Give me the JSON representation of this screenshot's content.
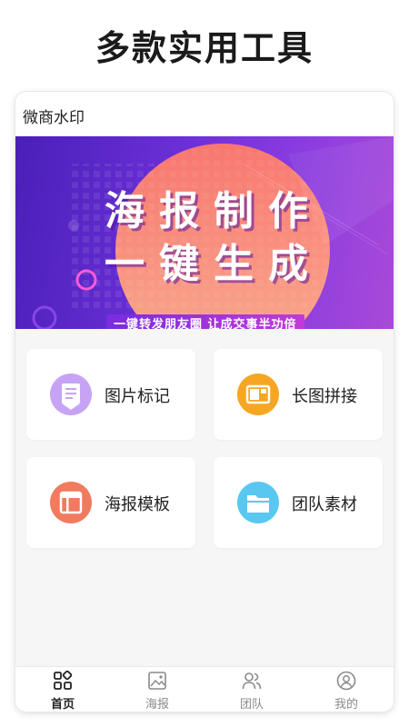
{
  "headline": "多款实用工具",
  "app": {
    "title": "微商水印"
  },
  "banner": {
    "line1": "海报制作",
    "line2": "一键生成",
    "tag": "一键转发朋友圈 让成交事半功倍"
  },
  "tools": [
    {
      "label": "图片标记",
      "icon": "image-mark-icon",
      "color": "#c7a3f5"
    },
    {
      "label": "长图拼接",
      "icon": "long-image-stitch-icon",
      "color": "#f6a623"
    },
    {
      "label": "海报模板",
      "icon": "poster-template-icon",
      "color": "#f27a5e"
    },
    {
      "label": "团队素材",
      "icon": "team-material-folder-icon",
      "color": "#58c8f0"
    }
  ],
  "tabs": [
    {
      "label": "首页",
      "icon": "home-grid-icon",
      "active": true
    },
    {
      "label": "海报",
      "icon": "image-icon",
      "active": false
    },
    {
      "label": "团队",
      "icon": "team-icon",
      "active": false
    },
    {
      "label": "我的",
      "icon": "profile-icon",
      "active": false
    }
  ]
}
